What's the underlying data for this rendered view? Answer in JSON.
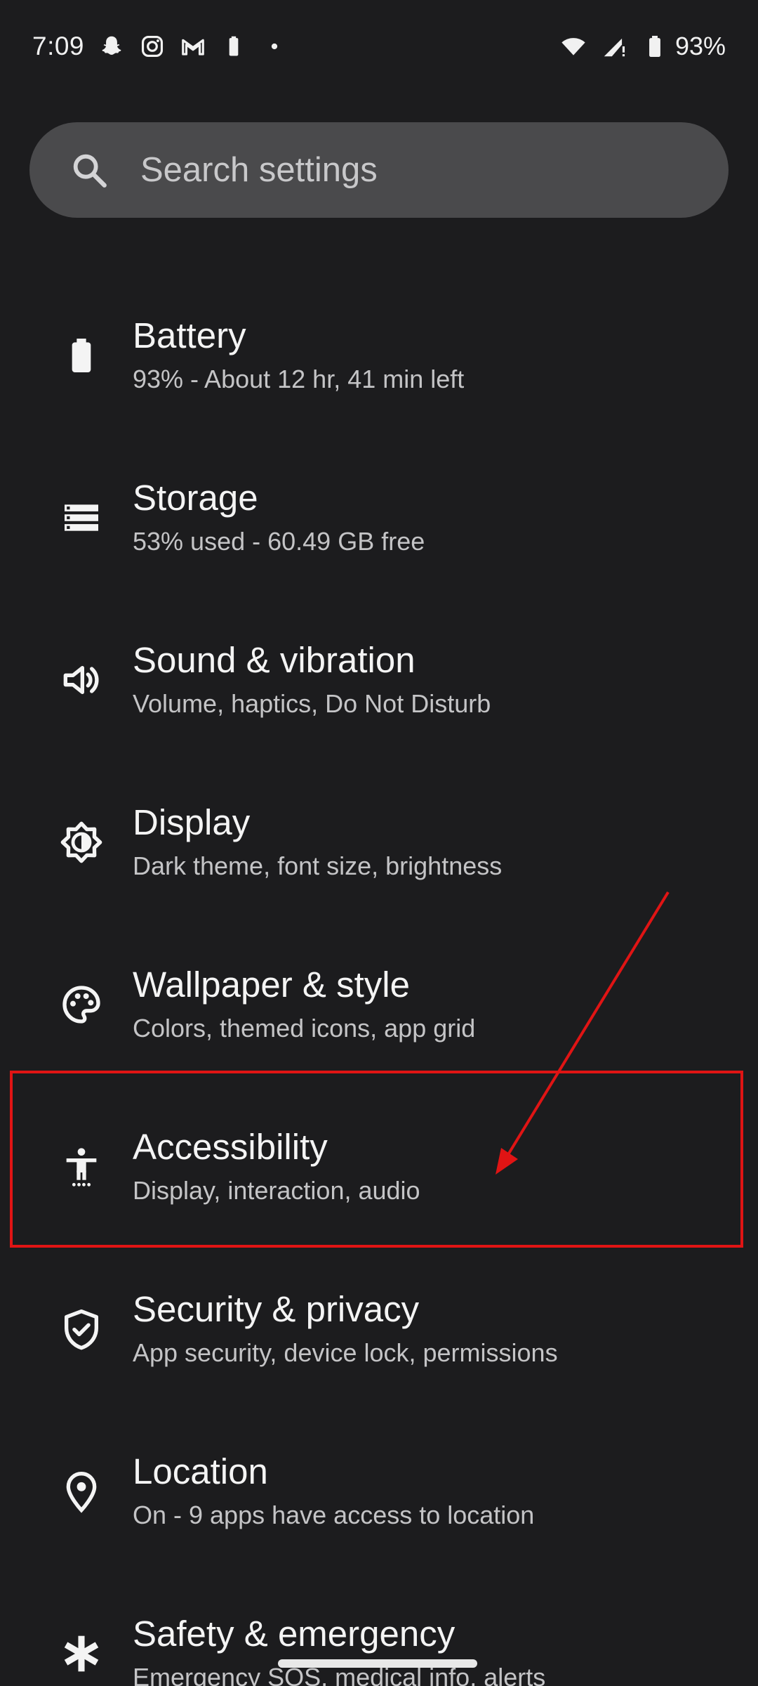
{
  "status_bar": {
    "time": "7:09",
    "notification_icons": [
      "snapchat-icon",
      "instagram-icon",
      "gmail-icon",
      "battery-saver-icon",
      "more-notifications-dot-icon"
    ],
    "battery_percent": "93%"
  },
  "search": {
    "placeholder": "Search settings"
  },
  "settings": [
    {
      "icon": "battery-icon",
      "title": "Battery",
      "subtitle": "93% - About 12 hr, 41 min left"
    },
    {
      "icon": "storage-icon",
      "title": "Storage",
      "subtitle": "53% used - 60.49 GB free"
    },
    {
      "icon": "sound-icon",
      "title": "Sound & vibration",
      "subtitle": "Volume, haptics, Do Not Disturb"
    },
    {
      "icon": "display-brightness-icon",
      "title": "Display",
      "subtitle": "Dark theme, font size, brightness"
    },
    {
      "icon": "palette-icon",
      "title": "Wallpaper & style",
      "subtitle": "Colors, themed icons, app grid"
    },
    {
      "icon": "accessibility-icon",
      "title": "Accessibility",
      "subtitle": "Display, interaction, audio"
    },
    {
      "icon": "shield-check-icon",
      "title": "Security & privacy",
      "subtitle": "App security, device lock, permissions"
    },
    {
      "icon": "location-pin-icon",
      "title": "Location",
      "subtitle": "On - 9 apps have access to location"
    },
    {
      "icon": "emergency-asterisk-icon",
      "title": "Safety & emergency",
      "subtitle": "Emergency SOS, medical info, alerts"
    }
  ],
  "annotation": {
    "color": "#e01414",
    "highlighted_item": "Accessibility"
  }
}
